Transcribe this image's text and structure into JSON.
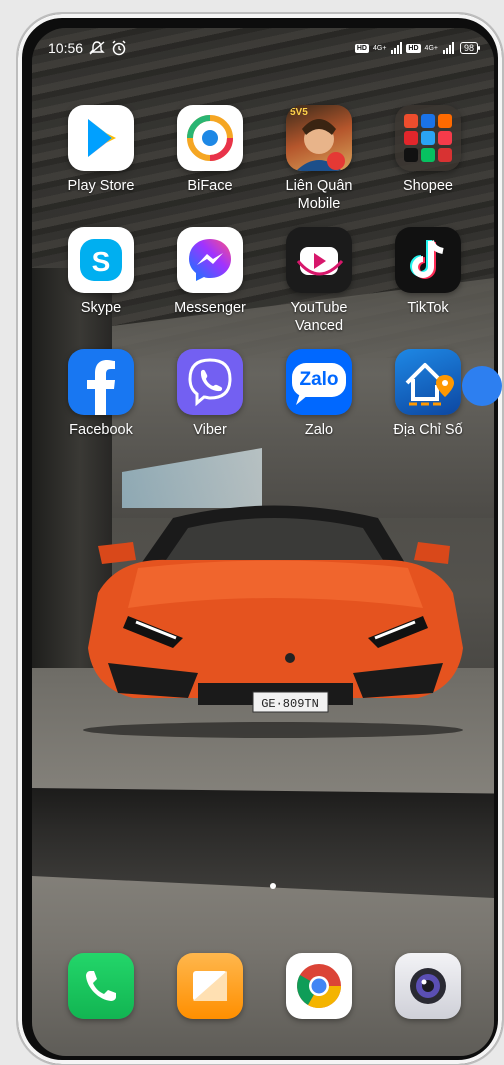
{
  "status_bar": {
    "time": "10:56",
    "net1": "4G+",
    "net2": "4G+",
    "hd": "HD",
    "battery": "98"
  },
  "apps": {
    "play_store": "Play Store",
    "biface": "BiFace",
    "lien_quan": "Liên Quân Mobile",
    "lien_quan_badge": "5V5",
    "shopee": "Shopee",
    "skype": "Skype",
    "messenger": "Messenger",
    "youtube_vanced": "YouTube Vanced",
    "tiktok": "TikTok",
    "facebook": "Facebook",
    "viber": "Viber",
    "zalo": "Zalo",
    "zalo_logo": "Zalo",
    "dia_chi_so": "Địa Chỉ Số",
    "plate": "GE·809TN"
  },
  "dock": {
    "phone": "phone-icon",
    "notes": "notes-icon",
    "chrome": "chrome-icon",
    "camera": "camera-icon"
  },
  "colors": {
    "accent_blue": "#2d7ff0",
    "car_orange": "#e5531f"
  }
}
